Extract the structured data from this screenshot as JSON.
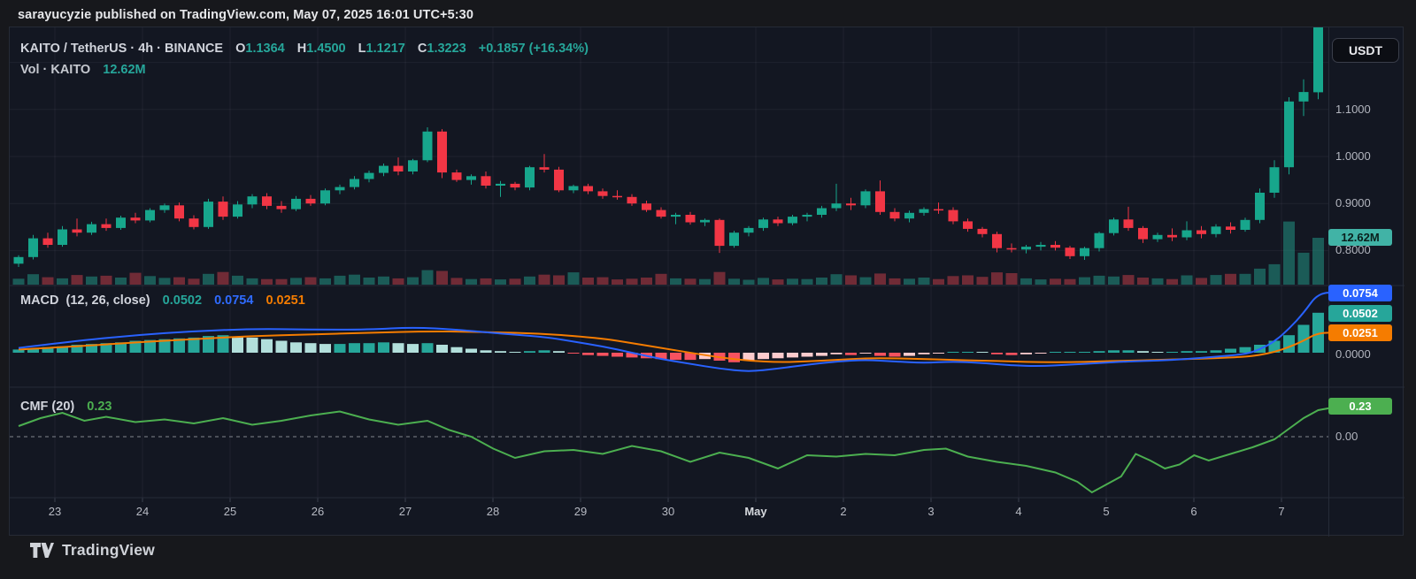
{
  "page": {
    "publisher_line": "sarayucyzie published on TradingView.com, May 07, 2025 16:01 UTC+5:30",
    "brand": "TradingView"
  },
  "main_legend": {
    "title": "KAITO / TetherUS · 4h · BINANCE",
    "o_label": "O",
    "o": "1.1364",
    "h_label": "H",
    "h": "1.4500",
    "l_label": "L",
    "l": "1.1217",
    "c_label": "C",
    "c": "1.3223",
    "change": "+0.1857 (+16.34%)"
  },
  "volume_legend": {
    "label": "Vol · KAITO",
    "value": "12.62M"
  },
  "macd_legend": {
    "title": "MACD",
    "params": "(12, 26, close)"
  },
  "cmf_legend": {
    "title": "CMF (20)"
  },
  "price_scale": {
    "currency": "USDT",
    "macd_zero": "0.0000",
    "cmf_zero": "0.00"
  },
  "colors": {
    "up": "#17a68c",
    "down": "#f23645",
    "vol_up": "rgba(34,148,132,0.55)",
    "vol_down": "rgba(205,63,73,0.50)",
    "macd_line": "#2962ff",
    "signal_line": "#f57c00",
    "hist_pos": "#26a69a",
    "hist_pos_weak": "#b2dfdb",
    "hist_neg": "#f7525f",
    "hist_neg_weak": "#fccbcd",
    "cmf_line": "#4caf50",
    "badge_macd": "#2962ff",
    "badge_hist": "#26a69a",
    "badge_signal": "#f57c00",
    "badge_cmf": "#4caf50",
    "badge_volume": "#41b3a6",
    "grid": "rgba(150,160,180,0.09)",
    "separator": "#262b38",
    "tick": "#3a3f4c"
  },
  "chart_data": {
    "type": "candlestick",
    "symbol": "KAITO / TetherUS",
    "interval": "4h",
    "exchange": "BINANCE",
    "ohlc_last": {
      "open": 1.1364,
      "high": 1.45,
      "low": 1.1217,
      "close": 1.3223,
      "change": "+0.1857",
      "change_pct": "+16.34%"
    },
    "y_axis": {
      "labels": [
        "1.1000",
        "1.0000",
        "0.9000",
        "0.8000"
      ],
      "label_prices": [
        1.1,
        1.0,
        0.9,
        0.8
      ],
      "gridline_prices": [
        1.2,
        1.1,
        1.0,
        0.9,
        0.8
      ]
    },
    "x_axis": {
      "labels": [
        "23",
        "24",
        "25",
        "26",
        "27",
        "28",
        "29",
        "30",
        "May",
        "2",
        "3",
        "4",
        "5",
        "6",
        "7"
      ]
    },
    "candles": [
      [
        0.772,
        0.79,
        0.765,
        0.786
      ],
      [
        0.786,
        0.833,
        0.781,
        0.826
      ],
      [
        0.826,
        0.838,
        0.806,
        0.812
      ],
      [
        0.812,
        0.852,
        0.808,
        0.845
      ],
      [
        0.845,
        0.868,
        0.83,
        0.838
      ],
      [
        0.838,
        0.861,
        0.833,
        0.856
      ],
      [
        0.856,
        0.868,
        0.842,
        0.848
      ],
      [
        0.848,
        0.874,
        0.844,
        0.87
      ],
      [
        0.87,
        0.88,
        0.858,
        0.864
      ],
      [
        0.864,
        0.89,
        0.86,
        0.886
      ],
      [
        0.886,
        0.9,
        0.88,
        0.896
      ],
      [
        0.896,
        0.902,
        0.862,
        0.868
      ],
      [
        0.868,
        0.875,
        0.845,
        0.85
      ],
      [
        0.85,
        0.91,
        0.846,
        0.904
      ],
      [
        0.904,
        0.915,
        0.865,
        0.872
      ],
      [
        0.872,
        0.905,
        0.868,
        0.898
      ],
      [
        0.898,
        0.92,
        0.89,
        0.915
      ],
      [
        0.915,
        0.922,
        0.888,
        0.895
      ],
      [
        0.895,
        0.905,
        0.88,
        0.888
      ],
      [
        0.888,
        0.916,
        0.884,
        0.91
      ],
      [
        0.91,
        0.918,
        0.895,
        0.9
      ],
      [
        0.9,
        0.932,
        0.896,
        0.928
      ],
      [
        0.928,
        0.94,
        0.92,
        0.935
      ],
      [
        0.935,
        0.958,
        0.93,
        0.952
      ],
      [
        0.952,
        0.97,
        0.945,
        0.965
      ],
      [
        0.965,
        0.985,
        0.958,
        0.98
      ],
      [
        0.98,
        0.998,
        0.96,
        0.968
      ],
      [
        0.968,
        0.995,
        0.962,
        0.992
      ],
      [
        0.992,
        1.062,
        0.988,
        1.053
      ],
      [
        1.053,
        1.058,
        0.954,
        0.966
      ],
      [
        0.966,
        0.972,
        0.946,
        0.95
      ],
      [
        0.95,
        0.962,
        0.94,
        0.958
      ],
      [
        0.958,
        0.968,
        0.932,
        0.938
      ],
      [
        0.938,
        0.948,
        0.914,
        0.942
      ],
      [
        0.942,
        0.946,
        0.928,
        0.934
      ],
      [
        0.934,
        0.98,
        0.928,
        0.977
      ],
      [
        0.977,
        1.005,
        0.966,
        0.972
      ],
      [
        0.972,
        0.978,
        0.924,
        0.928
      ],
      [
        0.928,
        0.94,
        0.922,
        0.937
      ],
      [
        0.937,
        0.942,
        0.92,
        0.926
      ],
      [
        0.926,
        0.932,
        0.91,
        0.916
      ],
      [
        0.916,
        0.928,
        0.908,
        0.914
      ],
      [
        0.914,
        0.92,
        0.895,
        0.9
      ],
      [
        0.9,
        0.906,
        0.882,
        0.886
      ],
      [
        0.886,
        0.892,
        0.868,
        0.872
      ],
      [
        0.872,
        0.88,
        0.856,
        0.876
      ],
      [
        0.876,
        0.882,
        0.855,
        0.86
      ],
      [
        0.86,
        0.868,
        0.852,
        0.865
      ],
      [
        0.865,
        0.868,
        0.795,
        0.81
      ],
      [
        0.81,
        0.842,
        0.806,
        0.838
      ],
      [
        0.838,
        0.852,
        0.83,
        0.848
      ],
      [
        0.848,
        0.87,
        0.842,
        0.866
      ],
      [
        0.866,
        0.872,
        0.852,
        0.858
      ],
      [
        0.858,
        0.876,
        0.854,
        0.872
      ],
      [
        0.872,
        0.88,
        0.862,
        0.876
      ],
      [
        0.876,
        0.895,
        0.87,
        0.89
      ],
      [
        0.89,
        0.942,
        0.884,
        0.9
      ],
      [
        0.9,
        0.912,
        0.886,
        0.896
      ],
      [
        0.896,
        0.93,
        0.89,
        0.926
      ],
      [
        0.926,
        0.949,
        0.876,
        0.882
      ],
      [
        0.882,
        0.89,
        0.862,
        0.868
      ],
      [
        0.868,
        0.885,
        0.86,
        0.88
      ],
      [
        0.88,
        0.892,
        0.874,
        0.888
      ],
      [
        0.888,
        0.902,
        0.878,
        0.886
      ],
      [
        0.886,
        0.892,
        0.856,
        0.862
      ],
      [
        0.862,
        0.868,
        0.84,
        0.846
      ],
      [
        0.846,
        0.85,
        0.828,
        0.835
      ],
      [
        0.835,
        0.84,
        0.796,
        0.805
      ],
      [
        0.805,
        0.815,
        0.796,
        0.802
      ],
      [
        0.802,
        0.812,
        0.794,
        0.808
      ],
      [
        0.808,
        0.818,
        0.8,
        0.812
      ],
      [
        0.812,
        0.82,
        0.8,
        0.806
      ],
      [
        0.806,
        0.81,
        0.782,
        0.788
      ],
      [
        0.788,
        0.808,
        0.78,
        0.805
      ],
      [
        0.805,
        0.84,
        0.798,
        0.837
      ],
      [
        0.837,
        0.87,
        0.832,
        0.866
      ],
      [
        0.866,
        0.893,
        0.842,
        0.848
      ],
      [
        0.848,
        0.852,
        0.816,
        0.824
      ],
      [
        0.824,
        0.838,
        0.818,
        0.833
      ],
      [
        0.833,
        0.847,
        0.82,
        0.828
      ],
      [
        0.828,
        0.862,
        0.822,
        0.843
      ],
      [
        0.843,
        0.852,
        0.826,
        0.835
      ],
      [
        0.835,
        0.856,
        0.828,
        0.851
      ],
      [
        0.851,
        0.86,
        0.836,
        0.844
      ],
      [
        0.844,
        0.87,
        0.84,
        0.865
      ],
      [
        0.865,
        0.932,
        0.858,
        0.923
      ],
      [
        0.923,
        0.992,
        0.912,
        0.977
      ],
      [
        0.977,
        1.126,
        0.962,
        1.117
      ],
      [
        1.117,
        1.164,
        1.086,
        1.137
      ],
      [
        1.1364,
        1.45,
        1.1217,
        1.3223
      ]
    ],
    "volume": {
      "current": "12.62M",
      "values_millions": [
        1.6,
        2.8,
        2.0,
        1.7,
        2.6,
        2.2,
        2.4,
        1.9,
        3.2,
        2.3,
        1.8,
        2.0,
        1.6,
        2.9,
        3.4,
        2.4,
        1.7,
        1.5,
        1.5,
        1.8,
        2.0,
        1.7,
        2.4,
        2.7,
        1.9,
        2.2,
        1.7,
        2.0,
        3.9,
        3.7,
        1.8,
        1.5,
        1.7,
        1.4,
        1.6,
        2.2,
        2.7,
        2.5,
        3.3,
        1.9,
        2.0,
        1.4,
        1.6,
        1.9,
        2.9,
        1.7,
        1.6,
        1.5,
        3.4,
        1.6,
        1.3,
        1.8,
        1.4,
        1.6,
        1.5,
        1.9,
        2.8,
        2.5,
        2.0,
        3.0,
        1.7,
        1.6,
        1.9,
        1.5,
        2.3,
        2.5,
        2.1,
        3.3,
        3.1,
        1.7,
        1.4,
        1.6,
        1.5,
        2.0,
        2.4,
        2.2,
        2.6,
        1.9,
        1.7,
        1.5,
        2.5,
        1.8,
        2.6,
        2.9,
        2.9,
        4.3,
        5.5,
        17.0,
        8.6,
        12.62
      ]
    },
    "macd": {
      "params": "(12, 26, close)",
      "last": {
        "hist": "0.0502",
        "macd": "0.0754",
        "signal": "0.0251"
      },
      "histogram": [
        0.004,
        0.005,
        0.007,
        0.008,
        0.01,
        0.011,
        0.012,
        0.013,
        0.015,
        0.016,
        0.017,
        0.018,
        0.019,
        0.021,
        0.022,
        0.02,
        0.019,
        0.017,
        0.015,
        0.013,
        0.012,
        0.011,
        0.011,
        0.012,
        0.012,
        0.013,
        0.012,
        0.011,
        0.012,
        0.01,
        0.007,
        0.005,
        0.003,
        0.002,
        0.001,
        0.002,
        0.003,
        0.002,
        -0.001,
        -0.003,
        -0.004,
        -0.005,
        -0.006,
        -0.007,
        -0.008,
        -0.009,
        -0.009,
        -0.008,
        -0.01,
        -0.012,
        -0.01,
        -0.008,
        -0.007,
        -0.006,
        -0.005,
        -0.004,
        -0.002,
        -0.003,
        -0.001,
        -0.004,
        -0.005,
        -0.004,
        -0.002,
        -0.001,
        0.001,
        0.001,
        0.0,
        -0.002,
        -0.003,
        -0.002,
        -0.001,
        0.0,
        0.001,
        0.001,
        0.002,
        0.003,
        0.003,
        0.002,
        0.001,
        0.001,
        0.002,
        0.002,
        0.003,
        0.005,
        0.007,
        0.01,
        0.015,
        0.022,
        0.035,
        0.0502
      ],
      "macd_line": [
        [
          0,
          0.006
        ],
        [
          4,
          0.015
        ],
        [
          8,
          0.022
        ],
        [
          12,
          0.027
        ],
        [
          16,
          0.03
        ],
        [
          20,
          0.029
        ],
        [
          24,
          0.029
        ],
        [
          27,
          0.032
        ],
        [
          30,
          0.029
        ],
        [
          33,
          0.024
        ],
        [
          36,
          0.02
        ],
        [
          38,
          0.014
        ],
        [
          40,
          0.008
        ],
        [
          42,
          0.0
        ],
        [
          44,
          -0.008
        ],
        [
          46,
          -0.014
        ],
        [
          48,
          -0.02
        ],
        [
          50,
          -0.024
        ],
        [
          52,
          -0.02
        ],
        [
          54,
          -0.015
        ],
        [
          56,
          -0.011
        ],
        [
          58,
          -0.009
        ],
        [
          60,
          -0.011
        ],
        [
          62,
          -0.013
        ],
        [
          64,
          -0.011
        ],
        [
          66,
          -0.013
        ],
        [
          68,
          -0.016
        ],
        [
          70,
          -0.017
        ],
        [
          72,
          -0.015
        ],
        [
          74,
          -0.013
        ],
        [
          76,
          -0.011
        ],
        [
          78,
          -0.01
        ],
        [
          80,
          -0.008
        ],
        [
          82,
          -0.005
        ],
        [
          84,
          -0.002
        ],
        [
          85,
          0.004
        ],
        [
          86,
          0.014
        ],
        [
          87,
          0.03
        ],
        [
          88,
          0.05
        ],
        [
          89,
          0.0754
        ],
        [
          90.5,
          0.0754
        ]
      ],
      "signal_line": [
        [
          0,
          0.004
        ],
        [
          4,
          0.008
        ],
        [
          8,
          0.013
        ],
        [
          12,
          0.017
        ],
        [
          16,
          0.021
        ],
        [
          20,
          0.023
        ],
        [
          24,
          0.025
        ],
        [
          28,
          0.027
        ],
        [
          32,
          0.026
        ],
        [
          36,
          0.024
        ],
        [
          40,
          0.018
        ],
        [
          42,
          0.012
        ],
        [
          44,
          0.006
        ],
        [
          46,
          0.0
        ],
        [
          48,
          -0.006
        ],
        [
          50,
          -0.01
        ],
        [
          52,
          -0.012
        ],
        [
          54,
          -0.011
        ],
        [
          56,
          -0.009
        ],
        [
          58,
          -0.007
        ],
        [
          60,
          -0.007
        ],
        [
          62,
          -0.008
        ],
        [
          64,
          -0.009
        ],
        [
          66,
          -0.01
        ],
        [
          68,
          -0.011
        ],
        [
          70,
          -0.012
        ],
        [
          72,
          -0.012
        ],
        [
          74,
          -0.011
        ],
        [
          76,
          -0.01
        ],
        [
          78,
          -0.009
        ],
        [
          80,
          -0.008
        ],
        [
          82,
          -0.007
        ],
        [
          84,
          -0.005
        ],
        [
          85,
          -0.003
        ],
        [
          86,
          0.001
        ],
        [
          87,
          0.007
        ],
        [
          88,
          0.015
        ],
        [
          89,
          0.0251
        ],
        [
          90.5,
          0.0251
        ]
      ]
    },
    "cmf": {
      "params": "(20)",
      "last": "0.23",
      "points": [
        [
          0,
          0.08
        ],
        [
          1.5,
          0.14
        ],
        [
          3,
          0.18
        ],
        [
          4.5,
          0.12
        ],
        [
          6,
          0.15
        ],
        [
          8,
          0.11
        ],
        [
          10,
          0.13
        ],
        [
          12,
          0.1
        ],
        [
          14,
          0.14
        ],
        [
          16,
          0.09
        ],
        [
          18,
          0.12
        ],
        [
          20,
          0.16
        ],
        [
          22,
          0.19
        ],
        [
          24,
          0.13
        ],
        [
          26,
          0.09
        ],
        [
          28,
          0.12
        ],
        [
          29.5,
          0.05
        ],
        [
          31,
          0.0
        ],
        [
          32.5,
          -0.09
        ],
        [
          34,
          -0.16
        ],
        [
          36,
          -0.11
        ],
        [
          38,
          -0.1
        ],
        [
          40,
          -0.13
        ],
        [
          42,
          -0.07
        ],
        [
          44,
          -0.11
        ],
        [
          46,
          -0.19
        ],
        [
          48,
          -0.12
        ],
        [
          50,
          -0.16
        ],
        [
          52,
          -0.24
        ],
        [
          54,
          -0.14
        ],
        [
          56,
          -0.15
        ],
        [
          58,
          -0.13
        ],
        [
          60,
          -0.14
        ],
        [
          62,
          -0.1
        ],
        [
          63.5,
          -0.09
        ],
        [
          65,
          -0.15
        ],
        [
          67,
          -0.19
        ],
        [
          69,
          -0.22
        ],
        [
          71,
          -0.27
        ],
        [
          72.5,
          -0.34
        ],
        [
          73.5,
          -0.42
        ],
        [
          74.5,
          -0.36
        ],
        [
          75.5,
          -0.3
        ],
        [
          76.5,
          -0.13
        ],
        [
          77.5,
          -0.18
        ],
        [
          78.5,
          -0.24
        ],
        [
          79.5,
          -0.21
        ],
        [
          80.5,
          -0.14
        ],
        [
          81.5,
          -0.18
        ],
        [
          83,
          -0.13
        ],
        [
          84.5,
          -0.08
        ],
        [
          86,
          -0.02
        ],
        [
          87,
          0.06
        ],
        [
          88,
          0.14
        ],
        [
          89,
          0.2
        ],
        [
          90.5,
          0.23
        ]
      ]
    }
  }
}
